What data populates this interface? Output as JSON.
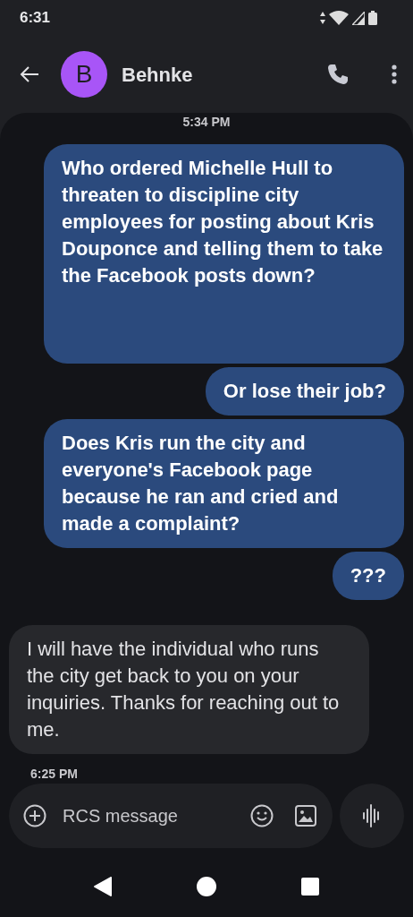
{
  "status_bar": {
    "time": "6:31"
  },
  "header": {
    "avatar_letter": "B",
    "contact_name": "Behnke"
  },
  "messages": [
    {
      "kind": "timestamp",
      "text": "5:34 PM"
    },
    {
      "kind": "outgoing",
      "text": "Who ordered Michelle Hull to threaten to discipline city employees for posting about Kris Douponce and telling them to take the Facebook  posts down?",
      "tall": true
    },
    {
      "kind": "outgoing",
      "text": "Or lose their job?",
      "tall": false
    },
    {
      "kind": "outgoing",
      "text": "Does Kris run the city and everyone's Facebook page because he ran and cried and made a complaint?",
      "tall": false
    },
    {
      "kind": "outgoing",
      "text": "???",
      "tall": false
    },
    {
      "kind": "incoming",
      "text": "I will have the individual who runs the city get back to you on your inquiries.  Thanks for reaching out to me."
    },
    {
      "kind": "timestamp",
      "text": "6:25 PM"
    }
  ],
  "composer": {
    "placeholder": "RCS message"
  }
}
